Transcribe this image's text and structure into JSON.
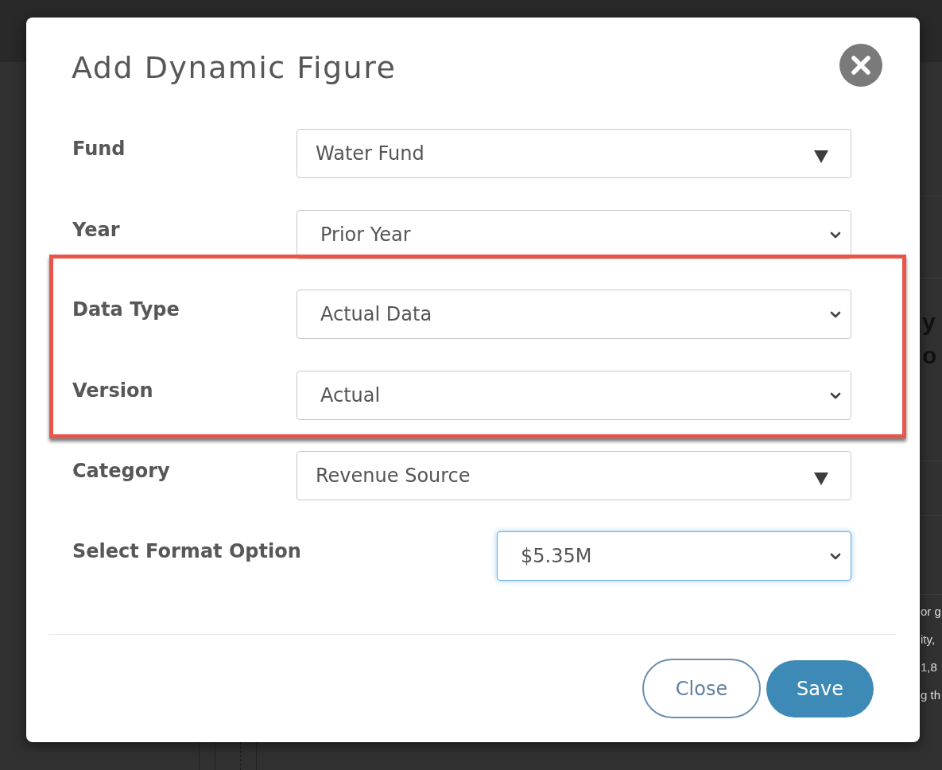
{
  "background_page": {
    "heading_fragments": [
      "y",
      "o"
    ],
    "text_fragments": [
      "or g",
      "ity,",
      "1,8",
      "g th"
    ]
  },
  "dialog": {
    "title": "Add Dynamic Figure",
    "fields": [
      {
        "label": "Fund",
        "kind": "combo",
        "value": "Water Fund",
        "highlighted": false
      },
      {
        "label": "Year",
        "kind": "select",
        "value": "Prior Year",
        "highlighted": false
      },
      {
        "label": "Data Type",
        "kind": "select",
        "value": "Actual Data",
        "highlighted": true
      },
      {
        "label": "Version",
        "kind": "select",
        "value": "Actual",
        "highlighted": true
      },
      {
        "label": "Category",
        "kind": "combo",
        "value": "Revenue Source",
        "highlighted": false
      }
    ],
    "format_option": {
      "label": "Select Format Option",
      "value": "$5.35M",
      "focused": true
    },
    "buttons": [
      {
        "label": "Close",
        "kind": "secondary"
      },
      {
        "label": "Save",
        "kind": "primary"
      }
    ]
  }
}
